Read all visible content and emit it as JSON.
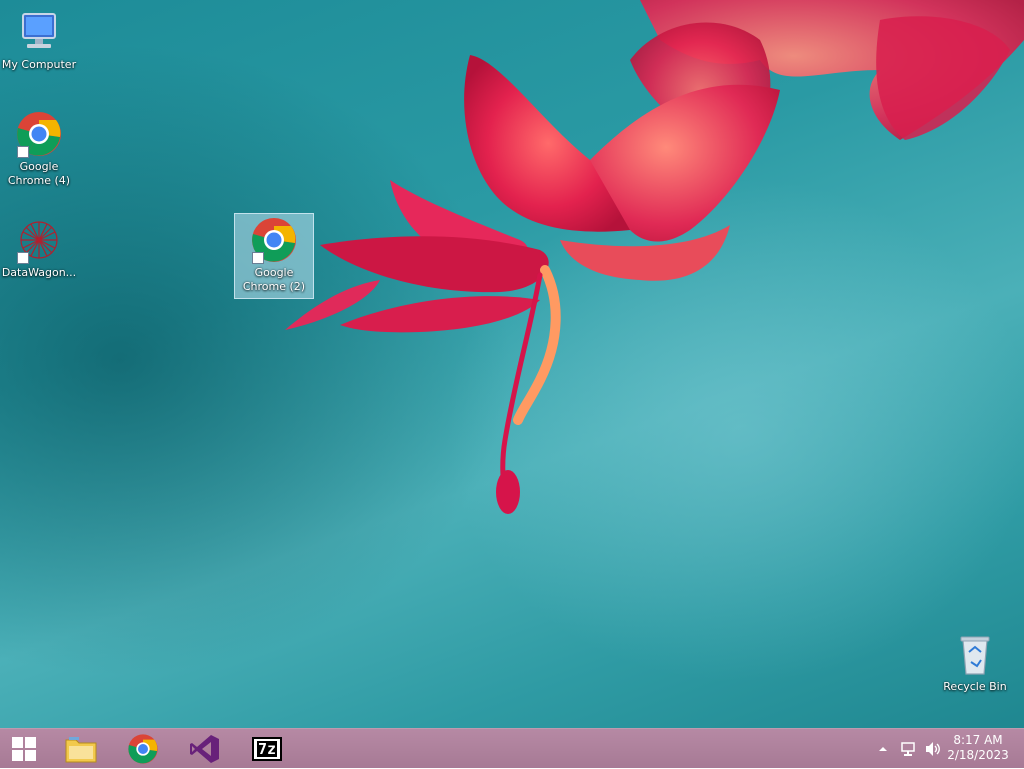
{
  "desktop": {
    "icons": [
      {
        "label": "My Computer",
        "icon": "my-computer-icon"
      },
      {
        "label": "Google Chrome (4)",
        "icon": "chrome-icon"
      },
      {
        "label": "DataWagon...",
        "icon": "datawagon-icon"
      },
      {
        "label": "Google Chrome (2)",
        "icon": "chrome-icon",
        "selected": true
      },
      {
        "label": "Recycle Bin",
        "icon": "recycle-bin-icon"
      }
    ]
  },
  "taskbar": {
    "pinned": [
      {
        "name": "Start",
        "icon": "windows-start-icon"
      },
      {
        "name": "File Explorer",
        "icon": "file-explorer-icon"
      },
      {
        "name": "Google Chrome",
        "icon": "chrome-icon"
      },
      {
        "name": "Visual Studio",
        "icon": "visual-studio-icon"
      },
      {
        "name": "7-Zip",
        "icon": "seven-zip-icon",
        "text": "7z"
      }
    ],
    "tray": {
      "icons": [
        "show-hidden-icons-icon",
        "network-icon",
        "volume-icon"
      ],
      "time": "8:17 AM",
      "date": "2/18/2023"
    }
  },
  "colors": {
    "taskbar": "#b07f9b",
    "wallpaper_teal": "#2a9aa4",
    "flower": "#e0234f",
    "selection": "#bee1f0"
  }
}
